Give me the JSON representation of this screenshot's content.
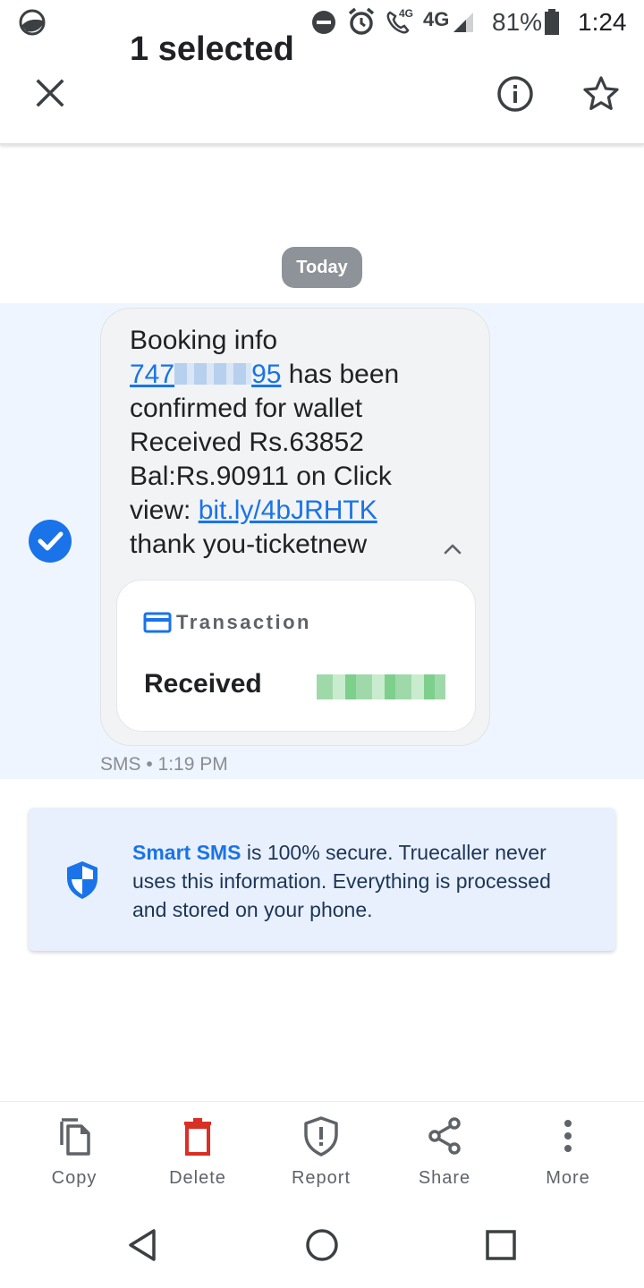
{
  "status_bar": {
    "network": "4G",
    "call_badge": "4G",
    "battery": "81%",
    "time": "1:24"
  },
  "app_bar": {
    "title": "1 selected",
    "icons": [
      "close-icon",
      "info-icon",
      "star-icon"
    ]
  },
  "conversation": {
    "date_chip": "Today",
    "message": {
      "line1": "Booking info",
      "phone_prefix": "747",
      "phone_suffix": "95",
      "line2_rest": " has been",
      "line3": "confirmed for wallet",
      "line4": "Received Rs.63852",
      "line5": "Bal:Rs.90911 on Click",
      "line6_prefix": "view: ",
      "link": "bit.ly/4bJRHTK",
      "line7": "thank you-ticketnew",
      "selected": true
    },
    "transaction_card": {
      "label": "Transaction",
      "received_label": "Received"
    },
    "meta": "SMS • 1:19 PM"
  },
  "smart_sms": {
    "strong": "Smart SMS",
    "text": " is 100% secure. Truecaller never uses this information. Everything is processed and stored on your phone."
  },
  "actions": [
    {
      "label": "Copy",
      "icon": "copy-icon"
    },
    {
      "label": "Delete",
      "icon": "delete-icon"
    },
    {
      "label": "Report",
      "icon": "report-icon"
    },
    {
      "label": "Share",
      "icon": "share-icon"
    },
    {
      "label": "More",
      "icon": "more-icon"
    }
  ],
  "colors": {
    "accent": "#1a73e8",
    "delete": "#d93025",
    "selection_band": "#eef5fe",
    "smart_card": "#e8f0fd"
  }
}
